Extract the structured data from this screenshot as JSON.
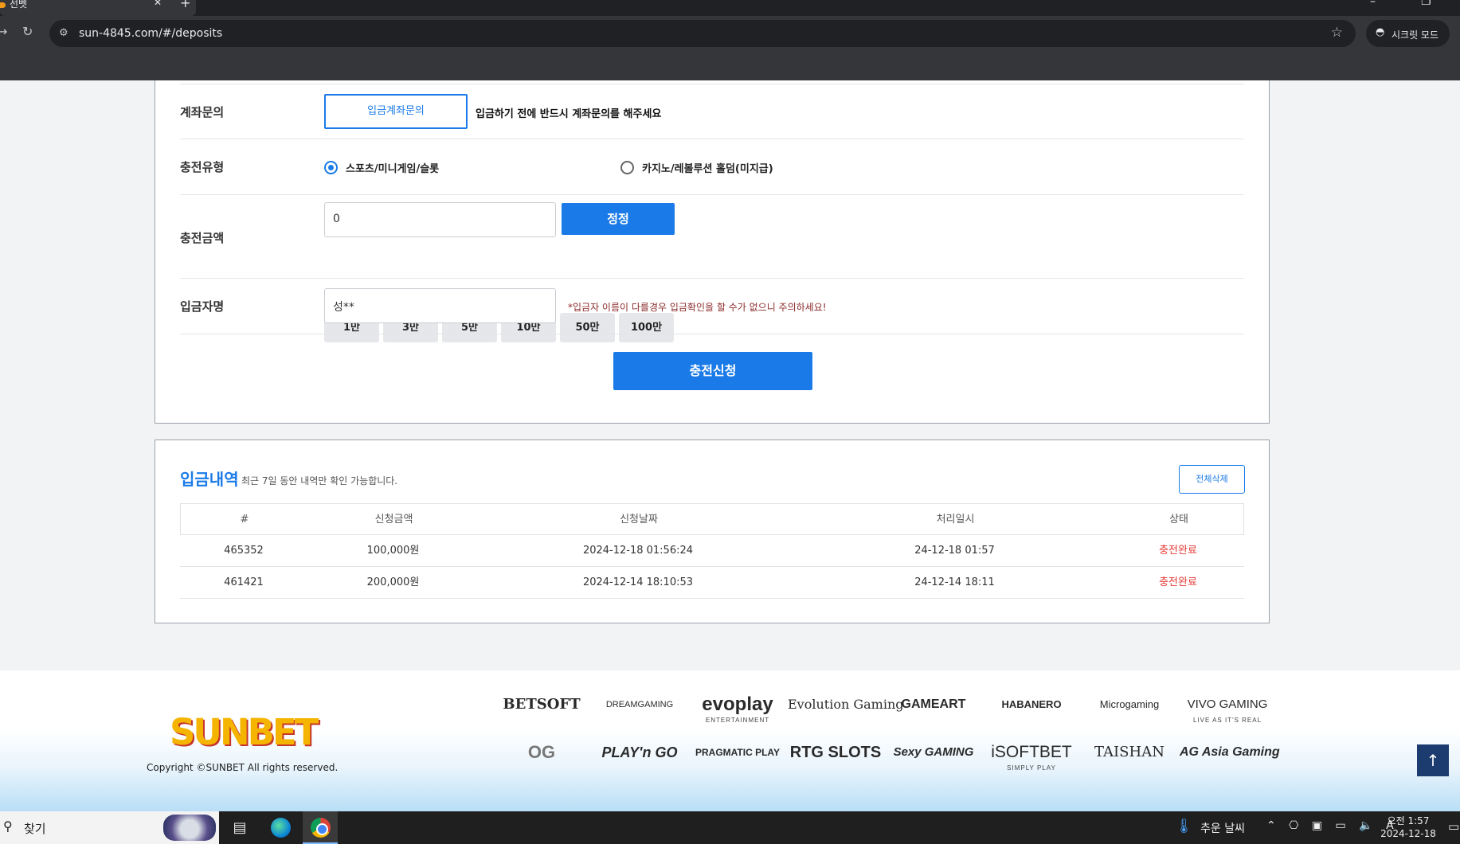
{
  "browser": {
    "tab_title": "선벳",
    "tab_close": "✕",
    "new_tab": "+",
    "url": "sun-4845.com/#/deposits",
    "incognito_label": "시크릿 모드",
    "win_minimize": "–",
    "win_restore": "❐"
  },
  "deposit_form": {
    "account_inquiry": {
      "label": "계좌문의",
      "button": "입금계좌문의",
      "notice": "입금하기 전에 반드시 계좌문의를 해주세요"
    },
    "charge_type": {
      "label": "충전유형",
      "options": [
        {
          "label": "스포츠/미니게임/슬롯",
          "selected": true
        },
        {
          "label": "카지노/레볼루션 홀덤(미지급)",
          "selected": false
        }
      ]
    },
    "charge_amount": {
      "label": "충전금액",
      "value": "0",
      "reset_button": "정정",
      "quick_amounts": [
        "1만",
        "3만",
        "5만",
        "10만",
        "50만",
        "100만"
      ]
    },
    "depositor": {
      "label": "입금자명",
      "value": "성**",
      "warning": "*입금자 이름이 다를경우 입금확인을 할 수가 없으니 주의하세요!"
    },
    "submit_button": "충전신청"
  },
  "history": {
    "title": "입금내역",
    "subtitle": "최근 7일 동안 내역만 확인 가능합니다.",
    "delete_all_button": "전체삭제",
    "columns": [
      "#",
      "신청금액",
      "신청날짜",
      "처리일시",
      "상태"
    ],
    "rows": [
      {
        "id": "465352",
        "amount": "100,000원",
        "requested": "2024-12-18 01:56:24",
        "processed": "24-12-18 01:57",
        "status": "충전완료"
      },
      {
        "id": "461421",
        "amount": "200,000원",
        "requested": "2024-12-14 18:10:53",
        "processed": "24-12-14 18:11",
        "status": "충전완료"
      }
    ],
    "status_color": "#e53935"
  },
  "footer": {
    "brand": "SUNBET",
    "copyright": "Copyright ©SUNBET All rights reserved.",
    "providers": [
      {
        "name": "BETSOFT",
        "sub": ""
      },
      {
        "name": "DREAMGAMING",
        "sub": ""
      },
      {
        "name": "evoplay",
        "sub": "ENTERTAINMENT"
      },
      {
        "name": "Evolution Gaming",
        "sub": ""
      },
      {
        "name": "GAMEART",
        "sub": ""
      },
      {
        "name": "HABANERO",
        "sub": ""
      },
      {
        "name": "Microgaming",
        "sub": ""
      },
      {
        "name": "VIVO GAMING",
        "sub": "LIVE AS IT'S REAL"
      },
      {
        "name": "OG",
        "sub": ""
      },
      {
        "name": "PLAY'n GO",
        "sub": ""
      },
      {
        "name": "PRAGMATIC PLAY",
        "sub": ""
      },
      {
        "name": "RTG SLOTS",
        "sub": ""
      },
      {
        "name": "Sexy GAMING",
        "sub": ""
      },
      {
        "name": "iSOFTBET",
        "sub": "SIMPLY PLAY"
      },
      {
        "name": "TAISHAN",
        "sub": ""
      },
      {
        "name": "AG Asia Gaming",
        "sub": ""
      }
    ]
  },
  "scroll_top": "↑",
  "accent_color": "#1a7be8",
  "taskbar": {
    "search_label": "찾기",
    "weather": "추운 날씨",
    "time": "오전 1:57",
    "date": "2024-12-18"
  }
}
